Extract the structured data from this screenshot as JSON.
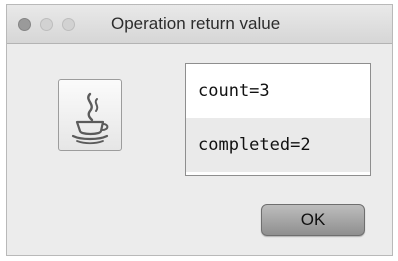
{
  "window": {
    "title": "Operation return value"
  },
  "icon": {
    "name": "java-coffee-cup-icon"
  },
  "results": {
    "items": [
      {
        "text": "count=3"
      },
      {
        "text": "completed=2"
      }
    ]
  },
  "buttons": {
    "ok_label": "OK"
  }
}
